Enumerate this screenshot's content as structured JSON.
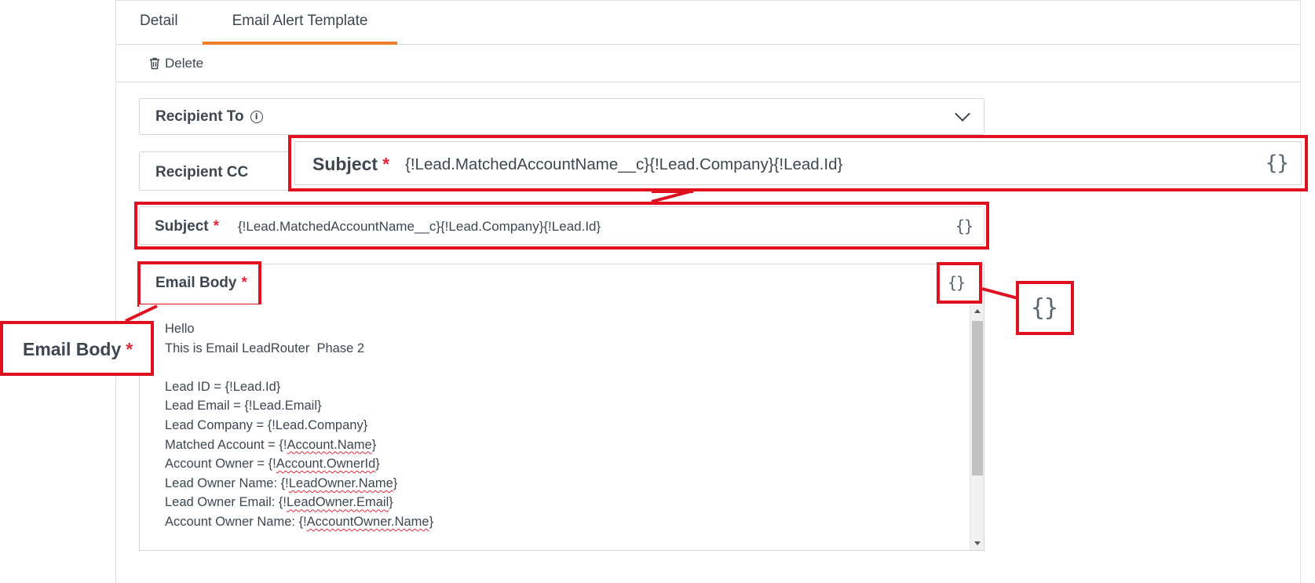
{
  "tabs": [
    {
      "label": "Detail",
      "active": false
    },
    {
      "label": "Email Alert Template",
      "active": true
    }
  ],
  "toolbar": {
    "delete_label": "Delete"
  },
  "form": {
    "recipient_to": {
      "label": "Recipient To"
    },
    "recipient_cc": {
      "label": "Recipient CC"
    },
    "subject": {
      "label": "Subject",
      "required_mark": "*",
      "value": "{!Lead.MatchedAccountName__c}{!Lead.Company}{!Lead.Id}"
    },
    "email_body": {
      "label": "Email Body",
      "required_mark": "*",
      "lines": [
        "Hello",
        "This is Email LeadRouter  Phase 2",
        "",
        "Lead ID = {!Lead.Id}",
        "Lead Email = {!Lead.Email}",
        "Lead Company = {!Lead.Company}",
        "Matched Account = {!Account.Name}",
        "Account Owner = {!Account.OwnerId}",
        "Lead Owner Name: {!LeadOwner.Name}",
        "Lead Owner Email: {!LeadOwner.Email}",
        "Account Owner Name: {!AccountOwner.Name}"
      ]
    },
    "merge_field_icon": "{}"
  },
  "colors": {
    "accent": "#f07d2c",
    "highlight": "#e0101e",
    "required": "#e0263a"
  },
  "icons": [
    "trash-icon",
    "info-icon",
    "chevron-down-icon",
    "merge-field-icon"
  ]
}
